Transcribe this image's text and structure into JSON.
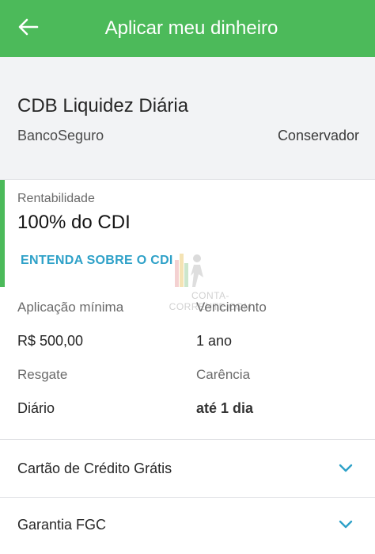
{
  "appbar": {
    "title": "Aplicar meu dinheiro",
    "back_icon": "arrow-left-icon"
  },
  "product": {
    "name": "CDB Liquidez Diária",
    "bank": "BancoSeguro",
    "risk_profile": "Conservador"
  },
  "rentabilidade": {
    "label": "Rentabilidade",
    "value": "100% do CDI",
    "link": "ENTENDA SOBRE O CDI"
  },
  "watermark": {
    "text": "CONTA-CORRENTE.COM"
  },
  "details": [
    {
      "label": "Aplicação mínima",
      "value": "R$ 500,00"
    },
    {
      "label": "Vencimento",
      "value": "1 ano"
    },
    {
      "label": "Resgate",
      "value": "Diário"
    },
    {
      "label": "Carência",
      "value": "até 1 dia"
    }
  ],
  "expandables": [
    {
      "label": "Cartão de Crédito Grátis"
    },
    {
      "label": "Garantia FGC"
    }
  ],
  "colors": {
    "primary": "#4cba5a",
    "link": "#2ea1c8",
    "chevron": "#2ea1c8"
  }
}
